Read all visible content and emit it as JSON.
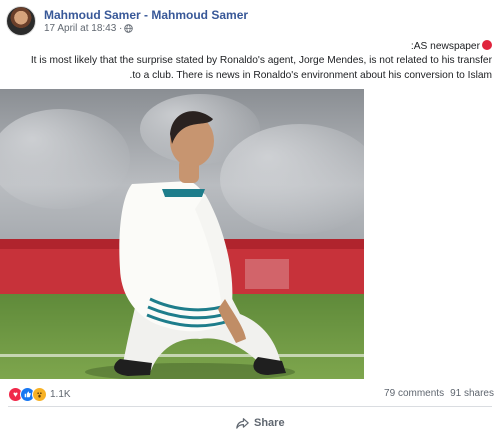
{
  "post": {
    "author": "Mahmoud Samer - Mahmoud Samer",
    "timestamp": "17 April at 18:43 ·",
    "text_line_1": ":AS newspaper",
    "text_line_2": "It is most likely that the surprise stated by Ronaldo's agent, Jorge Mendes, is not related to his transfer",
    "text_line_3": ".to a club. There is news in Ronaldo's environment about his conversion to Islam"
  },
  "engagement": {
    "reactions_count": "1.1K",
    "comments": "79 comments",
    "shares": "91 shares"
  },
  "actions": {
    "share_label": "Share"
  },
  "icons": [
    "globe-icon",
    "red-circle-icon",
    "love-reaction-icon",
    "like-reaction-icon",
    "wow-reaction-icon",
    "share-arrow-icon"
  ],
  "colors": {
    "author_link": "#385898",
    "meta_text": "#606770",
    "red_dot": "#e0243d"
  }
}
